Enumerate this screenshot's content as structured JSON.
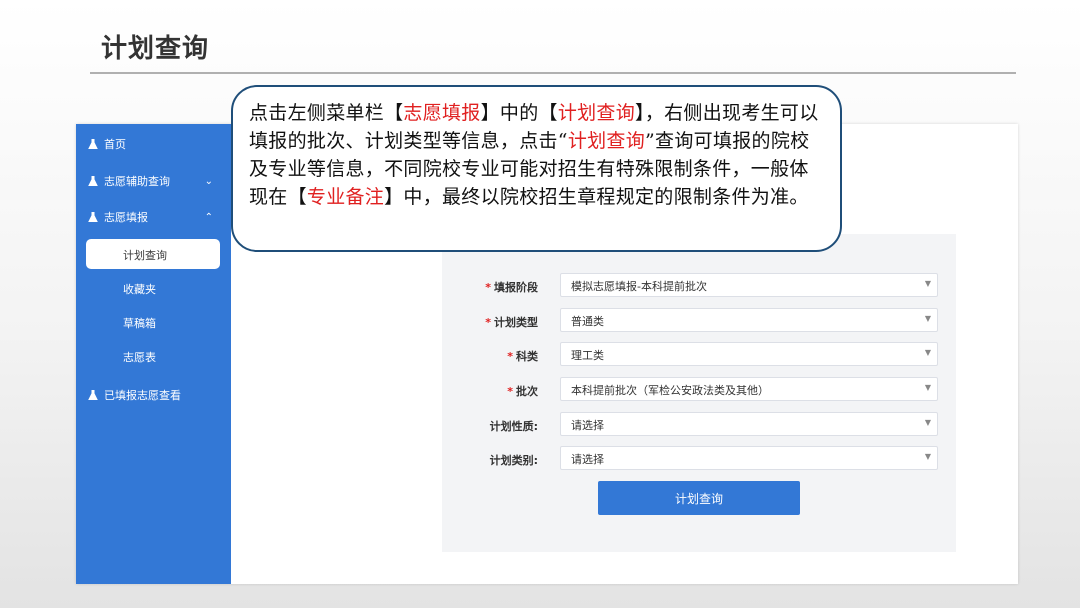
{
  "slide": {
    "title": "计划查询"
  },
  "sidebar": {
    "items": [
      {
        "label": "首页",
        "icon": "flask-icon"
      },
      {
        "label": "志愿辅助查询",
        "icon": "flask-icon",
        "chevron": "⌄"
      },
      {
        "label": "志愿填报",
        "icon": "flask-icon",
        "chevron": "⌃"
      },
      {
        "label": "已填报志愿查看",
        "icon": "flask-icon"
      }
    ],
    "subitems": [
      {
        "label": "计划查询",
        "active": true
      },
      {
        "label": "收藏夹"
      },
      {
        "label": "草稿箱"
      },
      {
        "label": "志愿表"
      }
    ]
  },
  "form": {
    "rows": [
      {
        "label": "填报阶段",
        "required": "*",
        "value": "模拟志愿填报-本科提前批次"
      },
      {
        "label": "计划类型",
        "required": "*",
        "value": "普通类"
      },
      {
        "label": "科类",
        "required": "*",
        "value": "理工类"
      },
      {
        "label": "批次",
        "required": "*",
        "value": "本科提前批次（军检公安政法类及其他）"
      },
      {
        "label": "计划性质:",
        "value": "请选择"
      },
      {
        "label": "计划类别:",
        "value": "请选择"
      }
    ],
    "submit_label": "计划查询"
  },
  "callout": {
    "segments": [
      {
        "text": "点击左侧菜单栏【",
        "red": false
      },
      {
        "text": "志愿填报",
        "red": true
      },
      {
        "text": "】中的【",
        "red": false
      },
      {
        "text": "计划查询",
        "red": true
      },
      {
        "text": "】，右侧出现考生可以填报的批次、计划类型等信息，点击“",
        "red": false
      },
      {
        "text": "计划查询",
        "red": true
      },
      {
        "text": "”查询可填报的院校及专业等信息，不同院校专业可能对招生有特殊限制条件，一般体现在【",
        "red": false
      },
      {
        "text": "专业备注",
        "red": true
      },
      {
        "text": "】中，最终以院校招生章程规定的限制条件为准。",
        "red": false
      }
    ]
  },
  "colors": {
    "sidebar_bg": "#3378d6",
    "primary_button": "#3378d6",
    "required_mark": "#e02020",
    "highlight_text": "#e02020",
    "callout_border": "#1f4e79"
  }
}
